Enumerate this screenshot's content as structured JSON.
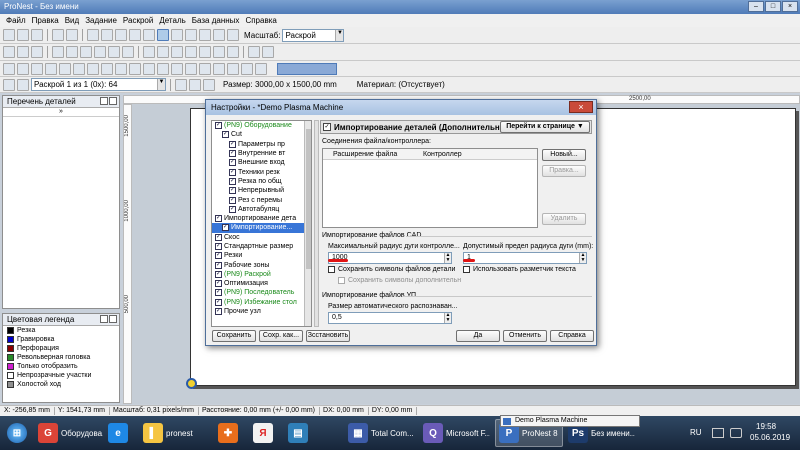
{
  "window": {
    "title": "ProNest - Без имени",
    "controls": [
      "–",
      "□",
      "×"
    ]
  },
  "menu": [
    "Файл",
    "Правка",
    "Вид",
    "Задание",
    "Раскрой",
    "Деталь",
    "База данных",
    "Справка"
  ],
  "toolbar": {
    "scale_label": "Масштаб:",
    "scale_value": "Раскрой"
  },
  "nestbar": {
    "nest_value": "Раскрой 1 из 1 (0x): 64",
    "size_label": "Размер: 3000,00 x 1500,00 mm",
    "material_label": "Материал: (Отсуствует)"
  },
  "parts_panel": {
    "title": "Перечень деталей"
  },
  "legend_panel": {
    "title": "Цветовая легенда",
    "items": [
      {
        "label": "Резка",
        "color": "#000000"
      },
      {
        "label": "Гравировка",
        "color": "#0000cc"
      },
      {
        "label": "Перфорация",
        "color": "#8b0000"
      },
      {
        "label": "Револьверная головка",
        "color": "#2a8a2a"
      },
      {
        "label": "Только отобразить",
        "color": "#d01fd0"
      },
      {
        "label": "Непрозрачные участки",
        "color": "#ffffff"
      },
      {
        "label": "Холостой ход",
        "color": "#909090"
      }
    ]
  },
  "rulers": {
    "top_tick": "2500,00",
    "left_ticks": [
      "1500,00",
      "1000,00",
      "500,00"
    ]
  },
  "dialog": {
    "title": "Настройки - *Demo Plasma Machine",
    "close": "×",
    "tree": [
      {
        "text": "(PN9) Оборудование",
        "green": true,
        "indent": 1,
        "sel": false
      },
      {
        "text": "Cut",
        "green": false,
        "indent": 2,
        "sel": false
      },
      {
        "text": "Параметры пр",
        "green": false,
        "indent": 3,
        "sel": false
      },
      {
        "text": "Внутренние вт",
        "green": false,
        "indent": 3,
        "sel": false
      },
      {
        "text": "Внешние вход",
        "green": false,
        "indent": 3,
        "sel": false
      },
      {
        "text": "Техники резк",
        "green": false,
        "indent": 3,
        "sel": false
      },
      {
        "text": "Резка по общ",
        "green": false,
        "indent": 3,
        "sel": false
      },
      {
        "text": "Непрерывный",
        "green": false,
        "indent": 3,
        "sel": false
      },
      {
        "text": "Рез с перемы",
        "green": false,
        "indent": 3,
        "sel": false
      },
      {
        "text": "Автотабуляц",
        "green": false,
        "indent": 3,
        "sel": false
      },
      {
        "text": "Импортирование дета",
        "green": false,
        "indent": 1,
        "sel": false
      },
      {
        "text": "Импортирование...",
        "green": false,
        "indent": 2,
        "sel": true
      },
      {
        "text": "Скос",
        "green": false,
        "indent": 1,
        "sel": false
      },
      {
        "text": "Стандартные размер",
        "green": false,
        "indent": 1,
        "sel": false
      },
      {
        "text": "Резки",
        "green": false,
        "indent": 1,
        "sel": false
      },
      {
        "text": "Рабочие зоны",
        "green": false,
        "indent": 1,
        "sel": false
      },
      {
        "text": "(PN9) Раскрой",
        "green": true,
        "indent": 1,
        "sel": false
      },
      {
        "text": "Оптимизация",
        "green": false,
        "indent": 1,
        "sel": false
      },
      {
        "text": "(PN9) Последователь",
        "green": true,
        "indent": 1,
        "sel": false
      },
      {
        "text": "(PN9) Избежание стол",
        "green": true,
        "indent": 1,
        "sel": false
      },
      {
        "text": "Прочие узл",
        "green": false,
        "indent": 1,
        "sel": false
      }
    ],
    "header": "Импортирование деталей (Дополнительно)",
    "goto_button": "Перейти к странице",
    "file_assoc": {
      "title": "Соединения файла/контроллера:",
      "col_ext": "Расширение файла",
      "col_ctrl": "Контроллер",
      "new_btn": "Новый...",
      "edit_btn": "Правка...",
      "delete_btn": "Удалить"
    },
    "cad": {
      "title": "Импортирование файлов CAD",
      "max_radius_label": "Максимальный радиус дуги контролле...",
      "max_radius_value": "1000",
      "tolerance_label": "Допустимый предел радиуса дуги (mm):",
      "tolerance_value": "1",
      "keep_symbols": "Сохранить символы файлов детали",
      "use_marker": "Использовать разметчик текста",
      "keep_extra": "Сохранить символы дополнительн"
    },
    "nc": {
      "title": "Импортирование файлов УП",
      "auto_size_label": "Размер автоматического распознаван...",
      "auto_size_value": "0,5"
    },
    "buttons": {
      "save": "Сохранить",
      "save_as": "Сохр. как...",
      "restore": "Зсстановить",
      "ok": "Да",
      "cancel": "Отменить",
      "help": "Справка"
    }
  },
  "status": {
    "x": "X: -256,85 mm",
    "y": "Y: 1541,73 mm",
    "scale": "Масштаб: 0,31 pixels/mm",
    "distance": "Расстояние: 0,00 mm (+/- 0,00 mm)",
    "dx": "DX: 0,00 mm",
    "dy": "DY: 0,00 mm"
  },
  "popup": "Demo Plasma Machine",
  "taskbar": {
    "items": [
      {
        "label": "Оборудова...",
        "icon_color": "#db4437",
        "icon_text": "G",
        "active": false
      },
      {
        "label": "",
        "icon_color": "#1e88e5",
        "icon_text": "e",
        "active": false
      },
      {
        "label": "pronest",
        "icon_color": "#f5c542",
        "icon_text": "▌",
        "active": false
      },
      {
        "label": "",
        "icon_color": "#e86e1c",
        "icon_text": "✚",
        "active": false
      },
      {
        "label": "",
        "icon_color": "#f2f2f2",
        "icon_text": "Я",
        "active": false
      },
      {
        "label": "",
        "icon_color": "#2f7fb8",
        "icon_text": "▤",
        "active": false
      },
      {
        "label": "Total Com...",
        "icon_color": "#3c5ba8",
        "icon_text": "▦",
        "active": false
      },
      {
        "label": "Microsoft F...",
        "icon_color": "#6a5bb8",
        "icon_text": "Q",
        "active": false
      },
      {
        "label": "ProNest 8",
        "icon_color": "#3a6fbf",
        "icon_text": "P",
        "active": true
      },
      {
        "label": "Без имени...",
        "icon_color": "#1d3b6b",
        "icon_text": "Ps",
        "active": false
      }
    ],
    "lang": "RU",
    "time": "19:58",
    "date": "05.06.2019"
  }
}
